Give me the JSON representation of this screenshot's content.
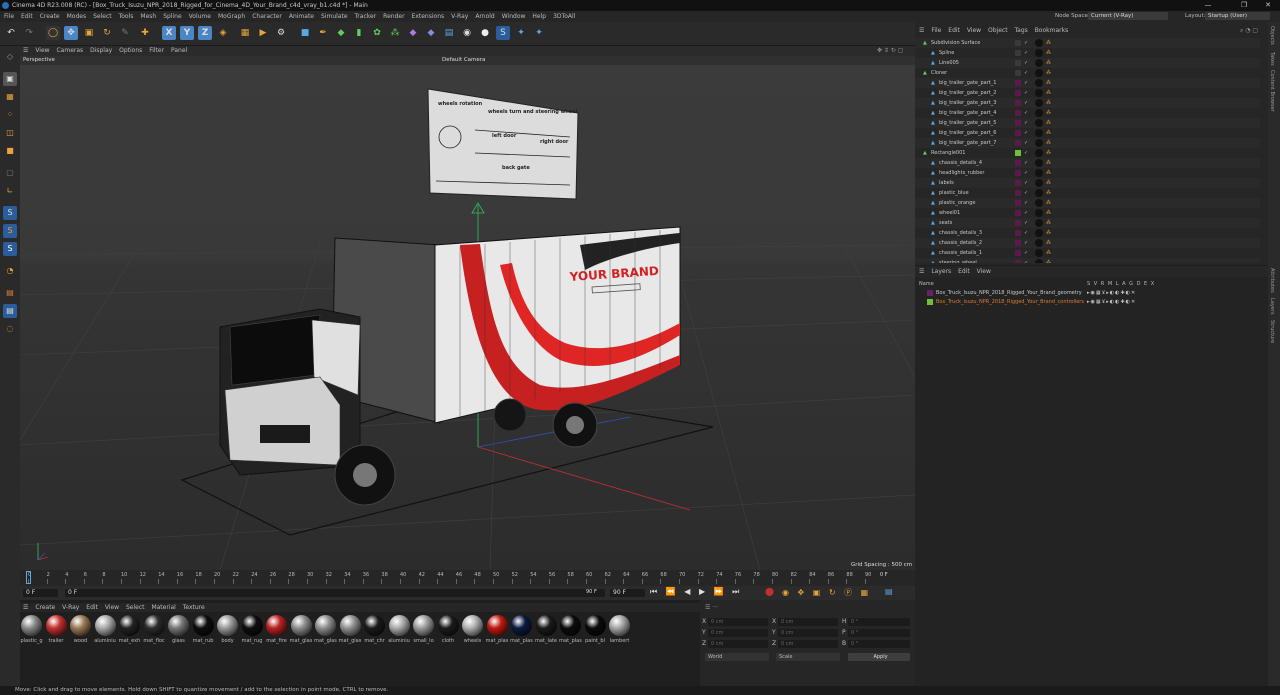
{
  "window": {
    "title": "Cinema 4D R23.008 (RC) - [Box_Truck_Isuzu_NPR_2018_Rigged_for_Cinema_4D_Your_Brand_c4d_vray_b1.c4d *] - Main"
  },
  "menubar": [
    "File",
    "Edit",
    "Create",
    "Modes",
    "Select",
    "Tools",
    "Mesh",
    "Spline",
    "Volume",
    "MoGraph",
    "Character",
    "Animate",
    "Simulate",
    "Tracker",
    "Render",
    "Extensions",
    "V-Ray",
    "Arnold",
    "Window",
    "Help",
    "3DToAll"
  ],
  "topright": {
    "node_space_label": "Node Space:",
    "node_space_value": "Current (V-Ray)",
    "layout_label": "Layout:",
    "layout_value": "Startup (User)"
  },
  "viewport": {
    "menu": [
      "View",
      "Cameras",
      "Display",
      "Options",
      "Filter",
      "Panel"
    ],
    "view_name": "Perspective",
    "camera": "Default Camera",
    "grid_spacing": "Grid Spacing : 500 cm",
    "billboard": {
      "wheels_rotation": "wheels rotation",
      "wheels_turn": "wheels turn and steering wheel",
      "left_door": "left door",
      "right_door": "right door",
      "back_gate": "back gate"
    },
    "brand_text": "YOUR BRAND"
  },
  "timeline": {
    "ticks": [
      "0",
      "2",
      "4",
      "6",
      "8",
      "10",
      "12",
      "14",
      "16",
      "18",
      "20",
      "22",
      "24",
      "26",
      "28",
      "30",
      "32",
      "34",
      "36",
      "38",
      "40",
      "42",
      "44",
      "46",
      "48",
      "50",
      "52",
      "54",
      "56",
      "58",
      "60",
      "62",
      "64",
      "66",
      "68",
      "70",
      "72",
      "74",
      "76",
      "78",
      "80",
      "82",
      "84",
      "86",
      "88",
      "90"
    ],
    "end_label": "0 F"
  },
  "transport": {
    "current_frame": "0 F",
    "start_frame": "0 F",
    "end_frame_a": "90 F",
    "end_frame_b": "90 F"
  },
  "material_menu": [
    "Create",
    "V-Ray",
    "Edit",
    "View",
    "Select",
    "Material",
    "Texture"
  ],
  "materials": [
    {
      "name": "plastic_g",
      "color": "#8a8a8a"
    },
    {
      "name": "trailer",
      "color": "#c23030"
    },
    {
      "name": "wood",
      "color": "#9a7a55"
    },
    {
      "name": "aluminiu",
      "color": "#a9a9a9"
    },
    {
      "name": "mat_exh",
      "color": "#222222"
    },
    {
      "name": "mat_floc",
      "color": "#2c2c2c"
    },
    {
      "name": "glass",
      "color": "#777777"
    },
    {
      "name": "mat_rub",
      "color": "#0d0d0d"
    },
    {
      "name": "body",
      "color": "#9a9a9a"
    },
    {
      "name": "mat_rug",
      "color": "#0e0e0e"
    },
    {
      "name": "mat_fire",
      "color": "#b82222"
    },
    {
      "name": "mat_glas",
      "color": "#8c8c8c"
    },
    {
      "name": "mat_glas",
      "color": "#8e8e8e"
    },
    {
      "name": "mat_glas",
      "color": "#909090"
    },
    {
      "name": "mat_chr",
      "color": "#1a1a1a"
    },
    {
      "name": "aluminiu",
      "color": "#aaaaaa"
    },
    {
      "name": "small_lo",
      "color": "#9b9b9b"
    },
    {
      "name": "cloth",
      "color": "#1c1c1c"
    },
    {
      "name": "wheels",
      "color": "#b0b0b0"
    },
    {
      "name": "mat_plas",
      "color": "#c01a10"
    },
    {
      "name": "mat_plas",
      "color": "#0b1a3e"
    },
    {
      "name": "mat_late",
      "color": "#1a1a1a"
    },
    {
      "name": "mat_plas",
      "color": "#0c0c0c"
    },
    {
      "name": "paint_bl",
      "color": "#0a0a0a"
    },
    {
      "name": "lambert",
      "color": "#a5a5a5"
    }
  ],
  "coords": {
    "labels": {
      "x": "X",
      "y": "Y",
      "z": "Z",
      "x2": "X",
      "y2": "Y",
      "z2": "Z",
      "h": "H",
      "p": "P",
      "b": "B"
    },
    "values": {
      "x": "0 cm",
      "y": "0 cm",
      "z": "0 cm",
      "x2": "0 cm",
      "y2": "0 cm",
      "z2": "0 cm",
      "h": "0 °",
      "p": "0 °",
      "b": "0 °"
    },
    "mode": "World",
    "scale": "Scale",
    "apply": "Apply"
  },
  "object_manager": {
    "menu": [
      "File",
      "Edit",
      "View",
      "Object",
      "Tags",
      "Bookmarks"
    ],
    "objects": [
      {
        "name": "Subdivision Surface",
        "indent": 0,
        "color": "#3a3a3a"
      },
      {
        "name": "Spline",
        "indent": 1,
        "color": "#3a3a3a"
      },
      {
        "name": "Line005",
        "indent": 1,
        "color": "#3a3a3a"
      },
      {
        "name": "Cloner",
        "indent": 0,
        "color": "#3a3a3a"
      },
      {
        "name": "big_trailer_gate_part_1",
        "indent": 1,
        "color": "#5a1a4a"
      },
      {
        "name": "big_trailer_gate_part_2",
        "indent": 1,
        "color": "#5a1a4a"
      },
      {
        "name": "big_trailer_gate_part_3",
        "indent": 1,
        "color": "#5a1a4a"
      },
      {
        "name": "big_trailer_gate_part_4",
        "indent": 1,
        "color": "#5a1a4a"
      },
      {
        "name": "big_trailer_gate_part_5",
        "indent": 1,
        "color": "#5a1a4a"
      },
      {
        "name": "big_trailer_gate_part_6",
        "indent": 1,
        "color": "#5a1a4a"
      },
      {
        "name": "big_trailer_gate_part_7",
        "indent": 1,
        "color": "#5a1a4a"
      },
      {
        "name": "Rectangle001",
        "indent": 0,
        "color": "#6fbf3a"
      },
      {
        "name": "chassis_details_4",
        "indent": 1,
        "color": "#5a1a4a"
      },
      {
        "name": "headlights_rubber",
        "indent": 1,
        "color": "#5a1a4a"
      },
      {
        "name": "labels",
        "indent": 1,
        "color": "#5a1a4a"
      },
      {
        "name": "plastic_blue",
        "indent": 1,
        "color": "#5a1a4a"
      },
      {
        "name": "plastic_orange",
        "indent": 1,
        "color": "#5a1a4a"
      },
      {
        "name": "wheel01",
        "indent": 1,
        "color": "#5a1a4a"
      },
      {
        "name": "seats",
        "indent": 1,
        "color": "#5a1a4a"
      },
      {
        "name": "chassis_details_3",
        "indent": 1,
        "color": "#5a1a4a"
      },
      {
        "name": "chassis_details_2",
        "indent": 1,
        "color": "#5a1a4a"
      },
      {
        "name": "chassis_details_1",
        "indent": 1,
        "color": "#5a1a4a"
      },
      {
        "name": "steering_wheel",
        "indent": 1,
        "color": "#5a1a4a"
      }
    ]
  },
  "layer_manager": {
    "menu": [
      "Layers",
      "Edit",
      "View"
    ],
    "header_name": "Name",
    "header_cols": "S V R M L A G D E X",
    "layers": [
      {
        "name": "Box_Truck_Isuzu_NPR_2018_Rigged_Your_Brand_geometry",
        "color": "#6a1f6a",
        "text_color": "#c8c8c8"
      },
      {
        "name": "Box_Truck_Isuzu_NPR_2018_Rigged_Your_Brand_controllers",
        "color": "#6fbf3a",
        "text_color": "#e07a2a"
      }
    ]
  },
  "right_tabs": [
    "Objects",
    "Takes",
    "Content Browser",
    "Attributes",
    "Layers",
    "Structure"
  ],
  "status": "Move: Click and drag to move elements. Hold down SHIFT to quantize movement / add to the selection in point mode, CTRL to remove."
}
